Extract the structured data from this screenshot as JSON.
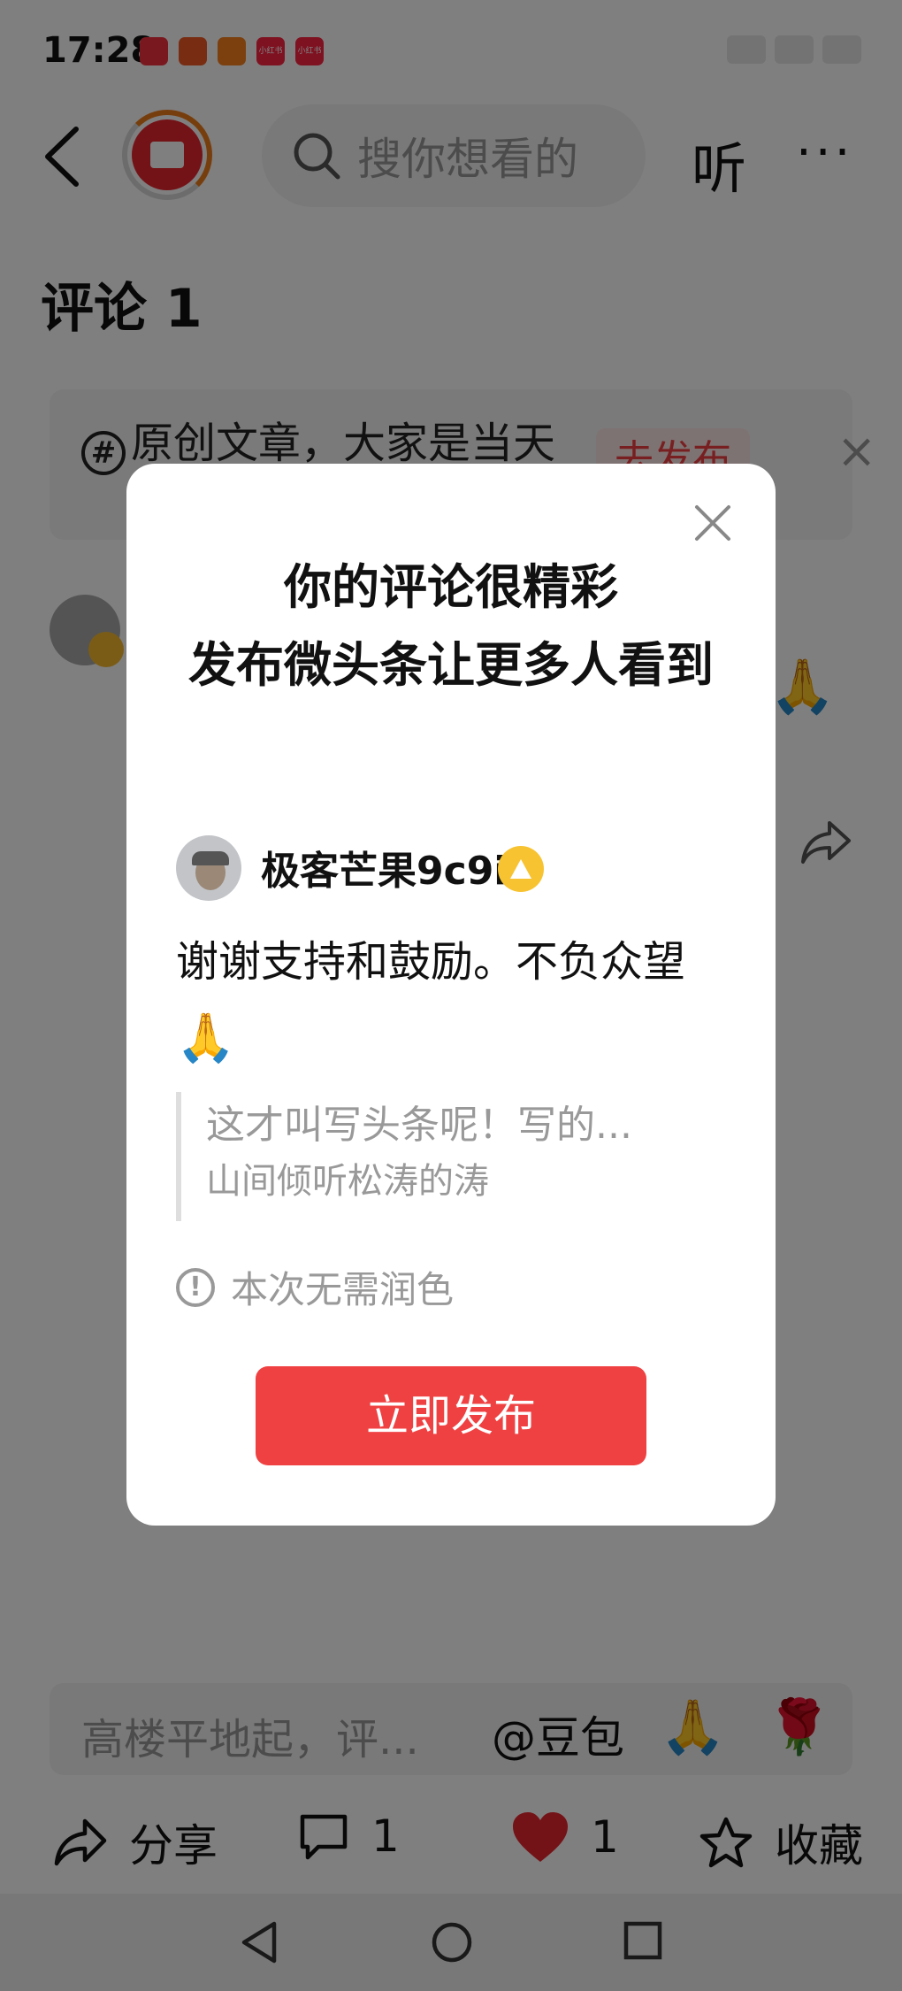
{
  "status_bar": {
    "time": "17:28",
    "apps": [
      {
        "name": "app-1",
        "label": "",
        "color": "#f3333f"
      },
      {
        "name": "app-2",
        "label": "",
        "color": "#f05a24"
      },
      {
        "name": "app-3",
        "label": "",
        "color": "#f7811d"
      },
      {
        "name": "app-4",
        "label": "小红书",
        "color": "#ff2442"
      },
      {
        "name": "app-5",
        "label": "小红书",
        "color": "#ff2442"
      }
    ]
  },
  "nav": {
    "search_placeholder": "搜你想看的",
    "listen_label": "听",
    "more_label": "···"
  },
  "comments": {
    "title": "评论 1"
  },
  "banner": {
    "text": "原创文章，大家是当天",
    "hash_icon": "#",
    "publish_label": "去发布",
    "close_label": "×"
  },
  "background_emoji": "🙏",
  "dialog": {
    "title_line1": "你的评论很精彩",
    "title_line2": "发布微头条让更多人看到",
    "username": "极客芒果9c9i",
    "comment_text": "谢谢支持和鼓励。不负众望",
    "comment_emoji": "🙏",
    "quote_line1": "这才叫写头条呢！写的...",
    "quote_line2": "山间倾听松涛的涛",
    "notice_icon": "!",
    "notice_text": "本次无需润色",
    "publish_button": "立即发布"
  },
  "input_bar": {
    "placeholder": "高楼平地起，评...",
    "at_label": "@豆包",
    "emoji1": "🙏",
    "emoji2": "🌹"
  },
  "actions": {
    "share_label": "分享",
    "comment_count": "1",
    "like_count": "1",
    "favorite_label": "收藏"
  },
  "colors": {
    "accent_red": "#f04142",
    "overlay": "rgba(0,0,0,0.5)"
  }
}
